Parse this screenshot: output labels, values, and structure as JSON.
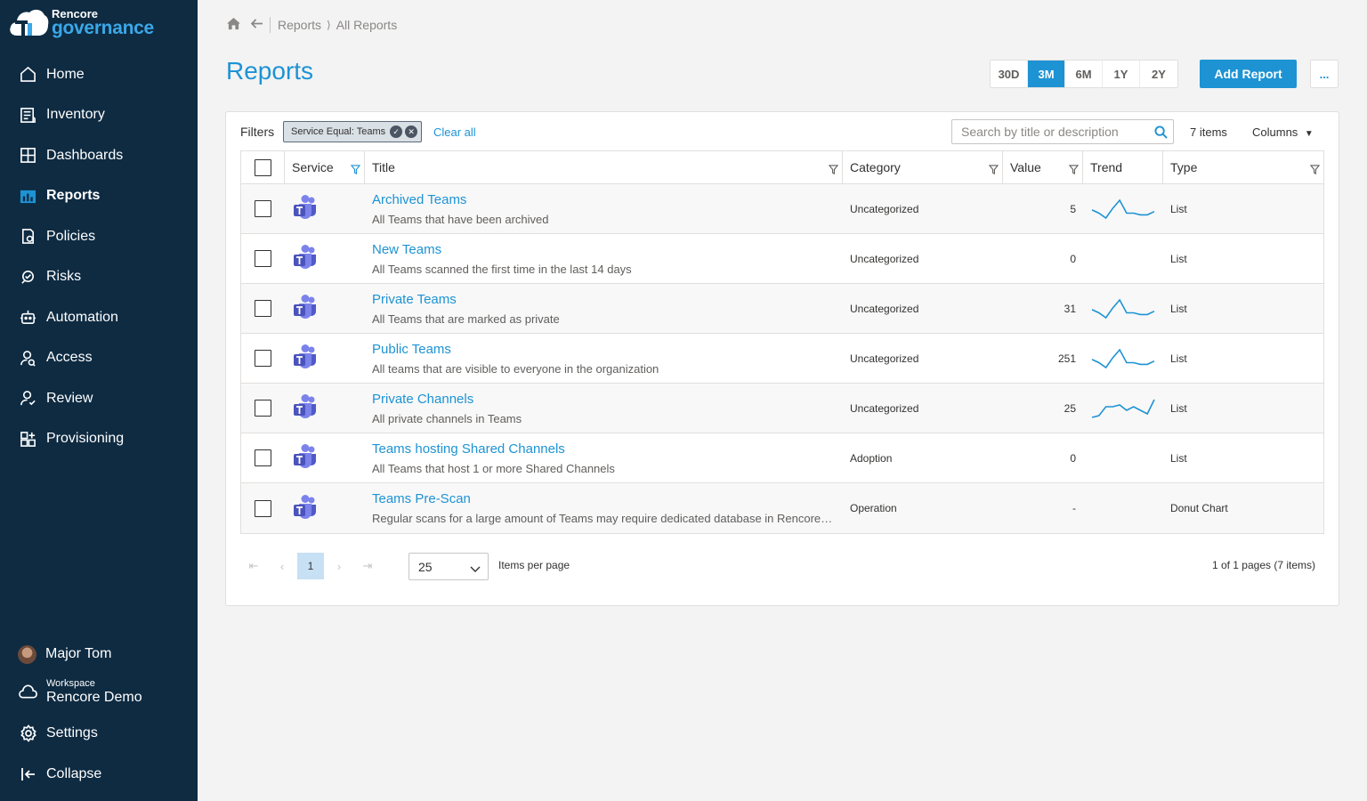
{
  "brand": {
    "line1": "Rencore",
    "line2": "governance"
  },
  "nav": [
    {
      "label": "Home",
      "icon": "home-icon",
      "active": false
    },
    {
      "label": "Inventory",
      "icon": "inventory-icon",
      "active": false
    },
    {
      "label": "Dashboards",
      "icon": "dashboards-icon",
      "active": false
    },
    {
      "label": "Reports",
      "icon": "reports-icon",
      "active": true
    },
    {
      "label": "Policies",
      "icon": "policies-icon",
      "active": false
    },
    {
      "label": "Risks",
      "icon": "risks-icon",
      "active": false
    },
    {
      "label": "Automation",
      "icon": "automation-icon",
      "active": false
    },
    {
      "label": "Access",
      "icon": "access-icon",
      "active": false
    },
    {
      "label": "Review",
      "icon": "review-icon",
      "active": false
    },
    {
      "label": "Provisioning",
      "icon": "provisioning-icon",
      "active": false
    }
  ],
  "user": {
    "name": "Major Tom"
  },
  "workspace": {
    "label": "Workspace",
    "name": "Rencore Demo"
  },
  "settings_label": "Settings",
  "collapse_label": "Collapse",
  "breadcrumb": {
    "items": [
      "Reports",
      "All Reports"
    ],
    "separator": "⟩"
  },
  "page_title": "Reports",
  "time_ranges": [
    "30D",
    "3M",
    "6M",
    "1Y",
    "2Y"
  ],
  "time_range_selected": "3M",
  "add_report_label": "Add Report",
  "more_label": "...",
  "filters": {
    "label": "Filters",
    "chip": "Service Equal: Teams",
    "clear_label": "Clear all"
  },
  "search": {
    "placeholder": "Search by title or description",
    "value": ""
  },
  "items_count": "7 items",
  "columns_label": "Columns",
  "columns": [
    "Service",
    "Title",
    "Category",
    "Value",
    "Trend",
    "Type"
  ],
  "rows": [
    {
      "title": "Archived Teams",
      "description": "All Teams that have been archived",
      "category": "Uncategorized",
      "value": "5",
      "trend": [
        8,
        6,
        3,
        9,
        14,
        6,
        6,
        5,
        5,
        7
      ],
      "type": "List"
    },
    {
      "title": "New Teams",
      "description": "All Teams scanned the first time in the last 14 days",
      "category": "Uncategorized",
      "value": "0",
      "trend": null,
      "type": "List"
    },
    {
      "title": "Private Teams",
      "description": "All Teams that are marked as private",
      "category": "Uncategorized",
      "value": "31",
      "trend": [
        8,
        6,
        3,
        9,
        14,
        6,
        6,
        5,
        5,
        7
      ],
      "type": "List"
    },
    {
      "title": "Public Teams",
      "description": "All teams that are visible to everyone in the organization",
      "category": "Uncategorized",
      "value": "251",
      "trend": [
        8,
        6,
        3,
        9,
        14,
        6,
        6,
        5,
        5,
        7
      ],
      "type": "List"
    },
    {
      "title": "Private Channels",
      "description": "All private channels in Teams",
      "category": "Uncategorized",
      "value": "25",
      "trend": [
        4,
        5,
        10,
        10,
        11,
        8,
        10,
        8,
        6,
        14
      ],
      "type": "List"
    },
    {
      "title": "Teams hosting Shared Channels",
      "description": "All Teams that host 1 or more Shared Channels",
      "category": "Adoption",
      "value": "0",
      "trend": null,
      "type": "List"
    },
    {
      "title": "Teams Pre-Scan",
      "description": "Regular scans for a large amount of Teams may require dedicated database in Rencore Governance",
      "category": "Operation",
      "value": "-",
      "trend": null,
      "type": "Donut Chart"
    }
  ],
  "pagination": {
    "current_page": "1",
    "per_page": "25",
    "per_page_label": "Items per page",
    "info": "1 of 1 pages (7 items)"
  },
  "colors": {
    "sidebar": "#0e2b42",
    "accent": "#1d93d4",
    "teams_purple": "#5b5fc7"
  }
}
